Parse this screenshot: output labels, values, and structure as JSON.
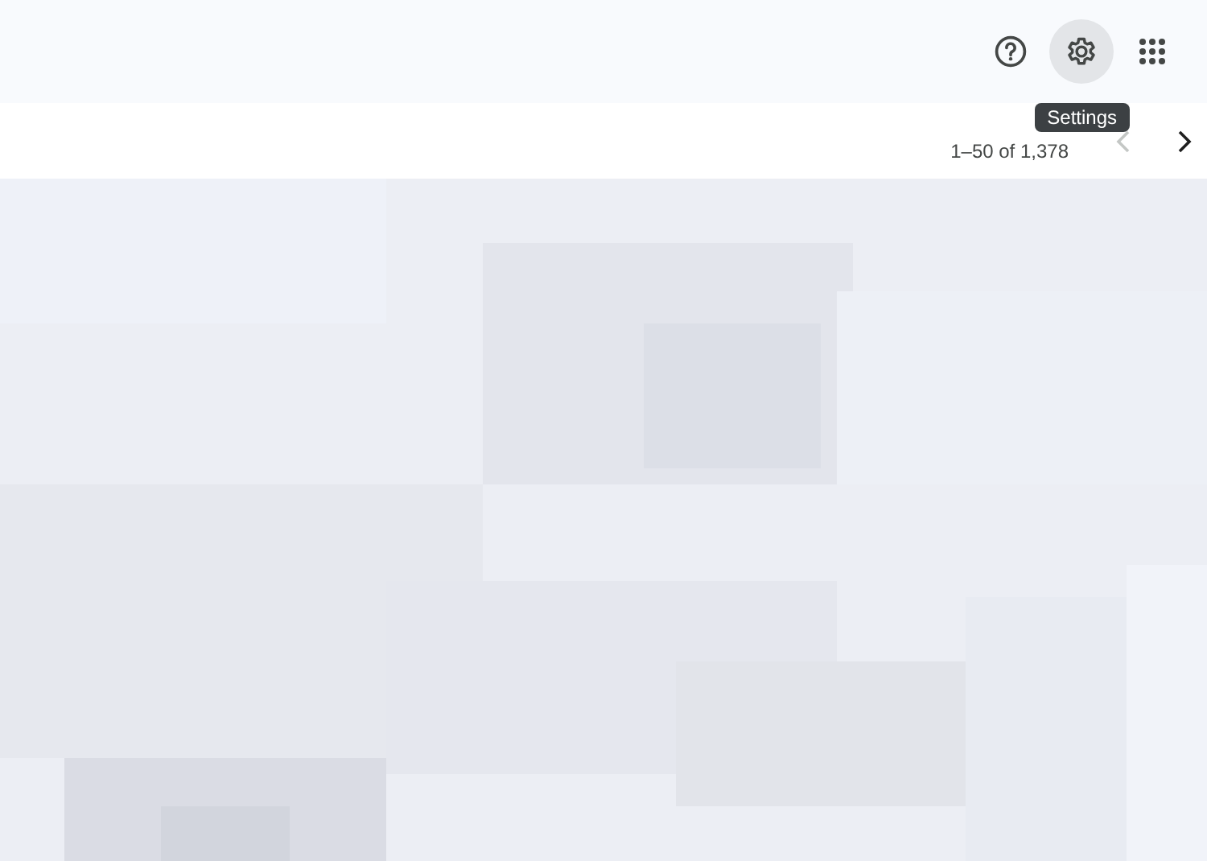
{
  "toolbar": {
    "buttons": [
      {
        "kind": "help",
        "selected": false
      },
      {
        "kind": "settings",
        "selected": true
      },
      {
        "kind": "apps",
        "selected": false
      }
    ],
    "tooltip": "Settings"
  },
  "pagination": {
    "range": "1–50 of 1,378",
    "previous_disabled": true,
    "next_disabled": false
  }
}
